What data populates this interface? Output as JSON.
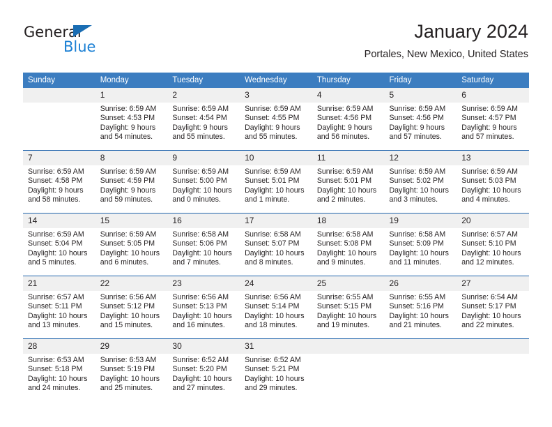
{
  "brand": {
    "name_part1": "General",
    "name_part2": "Blue",
    "triangle_icon": "triangle-icon",
    "accent_color": "#1a7fd4"
  },
  "header": {
    "title": "January 2024",
    "subtitle": "Portales, New Mexico, United States"
  },
  "theme": {
    "header_blue": "#3c7dc0",
    "separator_blue": "#1f63ac",
    "daynum_band": "#f0f0f0"
  },
  "calendar": {
    "weekday_headers": [
      "Sunday",
      "Monday",
      "Tuesday",
      "Wednesday",
      "Thursday",
      "Friday",
      "Saturday"
    ],
    "weeks": [
      [
        {
          "day": "",
          "sunrise": "",
          "sunset": "",
          "daylight_line1": "",
          "daylight_line2": ""
        },
        {
          "day": "1",
          "sunrise": "Sunrise: 6:59 AM",
          "sunset": "Sunset: 4:53 PM",
          "daylight_line1": "Daylight: 9 hours",
          "daylight_line2": "and 54 minutes."
        },
        {
          "day": "2",
          "sunrise": "Sunrise: 6:59 AM",
          "sunset": "Sunset: 4:54 PM",
          "daylight_line1": "Daylight: 9 hours",
          "daylight_line2": "and 55 minutes."
        },
        {
          "day": "3",
          "sunrise": "Sunrise: 6:59 AM",
          "sunset": "Sunset: 4:55 PM",
          "daylight_line1": "Daylight: 9 hours",
          "daylight_line2": "and 55 minutes."
        },
        {
          "day": "4",
          "sunrise": "Sunrise: 6:59 AM",
          "sunset": "Sunset: 4:56 PM",
          "daylight_line1": "Daylight: 9 hours",
          "daylight_line2": "and 56 minutes."
        },
        {
          "day": "5",
          "sunrise": "Sunrise: 6:59 AM",
          "sunset": "Sunset: 4:56 PM",
          "daylight_line1": "Daylight: 9 hours",
          "daylight_line2": "and 57 minutes."
        },
        {
          "day": "6",
          "sunrise": "Sunrise: 6:59 AM",
          "sunset": "Sunset: 4:57 PM",
          "daylight_line1": "Daylight: 9 hours",
          "daylight_line2": "and 57 minutes."
        }
      ],
      [
        {
          "day": "7",
          "sunrise": "Sunrise: 6:59 AM",
          "sunset": "Sunset: 4:58 PM",
          "daylight_line1": "Daylight: 9 hours",
          "daylight_line2": "and 58 minutes."
        },
        {
          "day": "8",
          "sunrise": "Sunrise: 6:59 AM",
          "sunset": "Sunset: 4:59 PM",
          "daylight_line1": "Daylight: 9 hours",
          "daylight_line2": "and 59 minutes."
        },
        {
          "day": "9",
          "sunrise": "Sunrise: 6:59 AM",
          "sunset": "Sunset: 5:00 PM",
          "daylight_line1": "Daylight: 10 hours",
          "daylight_line2": "and 0 minutes."
        },
        {
          "day": "10",
          "sunrise": "Sunrise: 6:59 AM",
          "sunset": "Sunset: 5:01 PM",
          "daylight_line1": "Daylight: 10 hours",
          "daylight_line2": "and 1 minute."
        },
        {
          "day": "11",
          "sunrise": "Sunrise: 6:59 AM",
          "sunset": "Sunset: 5:01 PM",
          "daylight_line1": "Daylight: 10 hours",
          "daylight_line2": "and 2 minutes."
        },
        {
          "day": "12",
          "sunrise": "Sunrise: 6:59 AM",
          "sunset": "Sunset: 5:02 PM",
          "daylight_line1": "Daylight: 10 hours",
          "daylight_line2": "and 3 minutes."
        },
        {
          "day": "13",
          "sunrise": "Sunrise: 6:59 AM",
          "sunset": "Sunset: 5:03 PM",
          "daylight_line1": "Daylight: 10 hours",
          "daylight_line2": "and 4 minutes."
        }
      ],
      [
        {
          "day": "14",
          "sunrise": "Sunrise: 6:59 AM",
          "sunset": "Sunset: 5:04 PM",
          "daylight_line1": "Daylight: 10 hours",
          "daylight_line2": "and 5 minutes."
        },
        {
          "day": "15",
          "sunrise": "Sunrise: 6:59 AM",
          "sunset": "Sunset: 5:05 PM",
          "daylight_line1": "Daylight: 10 hours",
          "daylight_line2": "and 6 minutes."
        },
        {
          "day": "16",
          "sunrise": "Sunrise: 6:58 AM",
          "sunset": "Sunset: 5:06 PM",
          "daylight_line1": "Daylight: 10 hours",
          "daylight_line2": "and 7 minutes."
        },
        {
          "day": "17",
          "sunrise": "Sunrise: 6:58 AM",
          "sunset": "Sunset: 5:07 PM",
          "daylight_line1": "Daylight: 10 hours",
          "daylight_line2": "and 8 minutes."
        },
        {
          "day": "18",
          "sunrise": "Sunrise: 6:58 AM",
          "sunset": "Sunset: 5:08 PM",
          "daylight_line1": "Daylight: 10 hours",
          "daylight_line2": "and 9 minutes."
        },
        {
          "day": "19",
          "sunrise": "Sunrise: 6:58 AM",
          "sunset": "Sunset: 5:09 PM",
          "daylight_line1": "Daylight: 10 hours",
          "daylight_line2": "and 11 minutes."
        },
        {
          "day": "20",
          "sunrise": "Sunrise: 6:57 AM",
          "sunset": "Sunset: 5:10 PM",
          "daylight_line1": "Daylight: 10 hours",
          "daylight_line2": "and 12 minutes."
        }
      ],
      [
        {
          "day": "21",
          "sunrise": "Sunrise: 6:57 AM",
          "sunset": "Sunset: 5:11 PM",
          "daylight_line1": "Daylight: 10 hours",
          "daylight_line2": "and 13 minutes."
        },
        {
          "day": "22",
          "sunrise": "Sunrise: 6:56 AM",
          "sunset": "Sunset: 5:12 PM",
          "daylight_line1": "Daylight: 10 hours",
          "daylight_line2": "and 15 minutes."
        },
        {
          "day": "23",
          "sunrise": "Sunrise: 6:56 AM",
          "sunset": "Sunset: 5:13 PM",
          "daylight_line1": "Daylight: 10 hours",
          "daylight_line2": "and 16 minutes."
        },
        {
          "day": "24",
          "sunrise": "Sunrise: 6:56 AM",
          "sunset": "Sunset: 5:14 PM",
          "daylight_line1": "Daylight: 10 hours",
          "daylight_line2": "and 18 minutes."
        },
        {
          "day": "25",
          "sunrise": "Sunrise: 6:55 AM",
          "sunset": "Sunset: 5:15 PM",
          "daylight_line1": "Daylight: 10 hours",
          "daylight_line2": "and 19 minutes."
        },
        {
          "day": "26",
          "sunrise": "Sunrise: 6:55 AM",
          "sunset": "Sunset: 5:16 PM",
          "daylight_line1": "Daylight: 10 hours",
          "daylight_line2": "and 21 minutes."
        },
        {
          "day": "27",
          "sunrise": "Sunrise: 6:54 AM",
          "sunset": "Sunset: 5:17 PM",
          "daylight_line1": "Daylight: 10 hours",
          "daylight_line2": "and 22 minutes."
        }
      ],
      [
        {
          "day": "28",
          "sunrise": "Sunrise: 6:53 AM",
          "sunset": "Sunset: 5:18 PM",
          "daylight_line1": "Daylight: 10 hours",
          "daylight_line2": "and 24 minutes."
        },
        {
          "day": "29",
          "sunrise": "Sunrise: 6:53 AM",
          "sunset": "Sunset: 5:19 PM",
          "daylight_line1": "Daylight: 10 hours",
          "daylight_line2": "and 25 minutes."
        },
        {
          "day": "30",
          "sunrise": "Sunrise: 6:52 AM",
          "sunset": "Sunset: 5:20 PM",
          "daylight_line1": "Daylight: 10 hours",
          "daylight_line2": "and 27 minutes."
        },
        {
          "day": "31",
          "sunrise": "Sunrise: 6:52 AM",
          "sunset": "Sunset: 5:21 PM",
          "daylight_line1": "Daylight: 10 hours",
          "daylight_line2": "and 29 minutes."
        },
        {
          "day": "",
          "sunrise": "",
          "sunset": "",
          "daylight_line1": "",
          "daylight_line2": ""
        },
        {
          "day": "",
          "sunrise": "",
          "sunset": "",
          "daylight_line1": "",
          "daylight_line2": ""
        },
        {
          "day": "",
          "sunrise": "",
          "sunset": "",
          "daylight_line1": "",
          "daylight_line2": ""
        }
      ]
    ]
  }
}
